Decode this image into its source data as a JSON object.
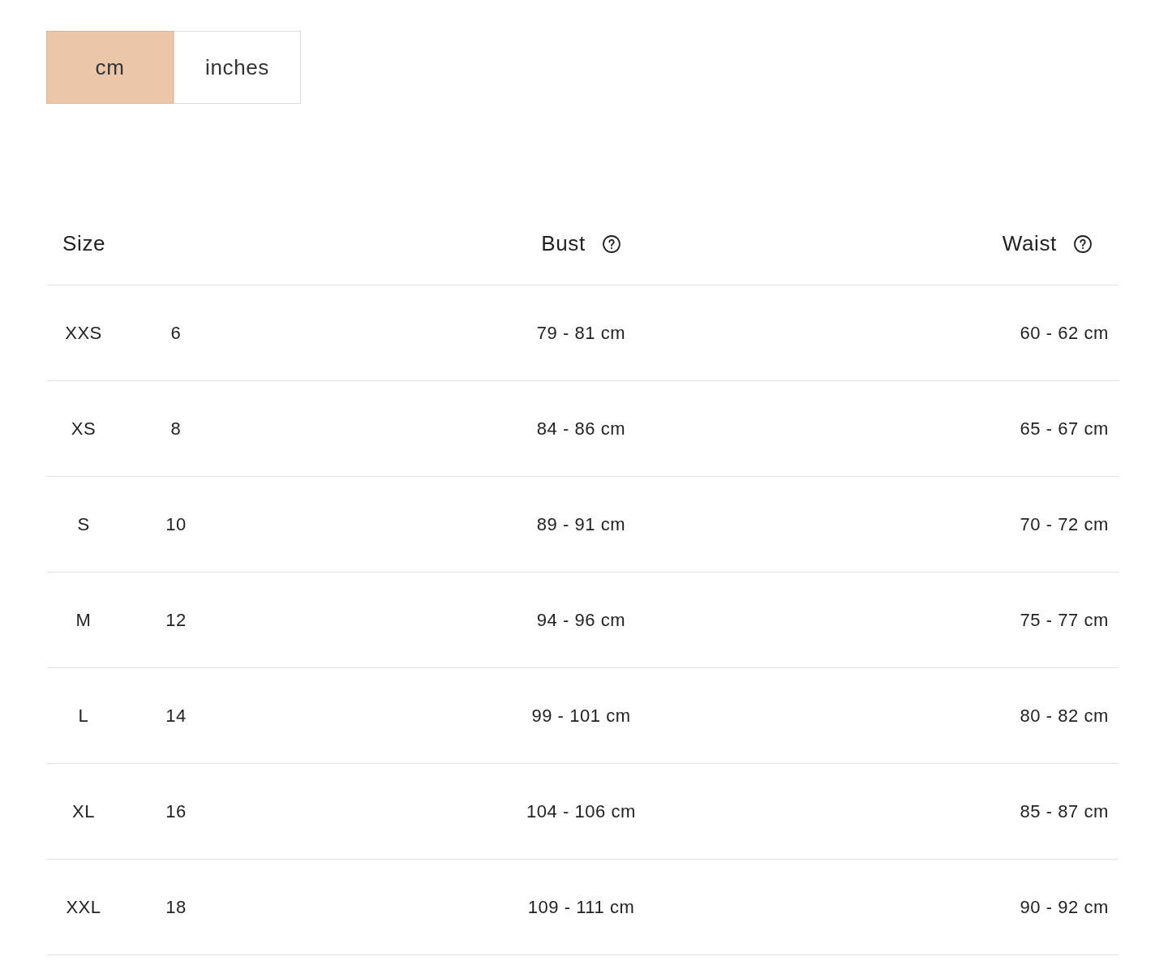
{
  "unit_tabs": [
    {
      "label": "cm",
      "selected": true
    },
    {
      "label": "inches",
      "selected": false
    }
  ],
  "table": {
    "columns": [
      {
        "label": "Size",
        "help": false
      },
      {
        "label": "Bust",
        "help": true
      },
      {
        "label": "Waist",
        "help": true
      }
    ],
    "rows": [
      {
        "size": "XXS",
        "number": "6",
        "bust": "79 - 81 cm",
        "waist": "60 - 62 cm"
      },
      {
        "size": "XS",
        "number": "8",
        "bust": "84 - 86 cm",
        "waist": "65 - 67 cm"
      },
      {
        "size": "S",
        "number": "10",
        "bust": "89 - 91 cm",
        "waist": "70 - 72 cm"
      },
      {
        "size": "M",
        "number": "12",
        "bust": "94 - 96 cm",
        "waist": "75 - 77 cm"
      },
      {
        "size": "L",
        "number": "14",
        "bust": "99 - 101 cm",
        "waist": "80 - 82 cm"
      },
      {
        "size": "XL",
        "number": "16",
        "bust": "104 - 106 cm",
        "waist": "85 - 87 cm"
      },
      {
        "size": "XXL",
        "number": "18",
        "bust": "109 - 111 cm",
        "waist": "90 - 92 cm"
      }
    ]
  }
}
